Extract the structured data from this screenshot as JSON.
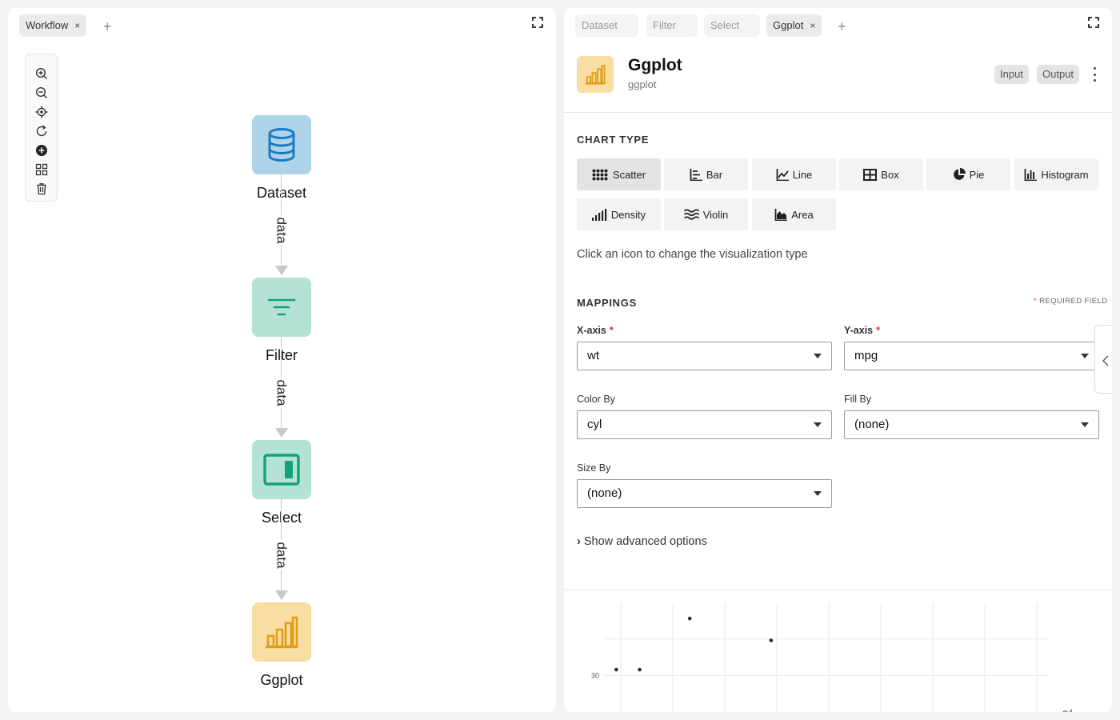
{
  "workflow": {
    "tab_label": "Workflow",
    "close_glyph": "×",
    "add_glyph": "+",
    "toolbar_icons": [
      "zoom-in-icon",
      "zoom-out-icon",
      "center-icon",
      "refresh-icon",
      "add-node-icon",
      "layout-icon",
      "trash-icon"
    ],
    "nodes": [
      {
        "label": "Dataset",
        "color": "#aed4ea",
        "icon": "database-icon"
      },
      {
        "label": "Filter",
        "color": "#b4e3d5",
        "icon": "filter-icon"
      },
      {
        "label": "Select",
        "color": "#b4e3d5",
        "icon": "select-columns-icon"
      },
      {
        "label": "Ggplot",
        "color": "#f9dea3",
        "icon": "bar-chart-icon"
      }
    ],
    "edge_label": "data"
  },
  "editor": {
    "tabs": [
      {
        "label": "Dataset"
      },
      {
        "label": "Filter"
      },
      {
        "label": "Select"
      },
      {
        "label": "Ggplot",
        "active": true
      }
    ],
    "close_glyph": "×",
    "add_glyph": "+",
    "node_title": "Ggplot",
    "node_subtitle": "ggplot",
    "input_label": "Input",
    "output_label": "Output",
    "chart_type_heading": "CHART TYPE",
    "chart_types": [
      {
        "label": "Scatter",
        "icon": "scatter-icon",
        "selected": true
      },
      {
        "label": "Bar",
        "icon": "bar-icon"
      },
      {
        "label": "Line",
        "icon": "line-icon"
      },
      {
        "label": "Box",
        "icon": "box-icon"
      },
      {
        "label": "Pie",
        "icon": "pie-icon"
      },
      {
        "label": "Histogram",
        "icon": "histogram-icon"
      },
      {
        "label": "Density",
        "icon": "density-icon"
      },
      {
        "label": "Violin",
        "icon": "violin-icon"
      },
      {
        "label": "Area",
        "icon": "area-icon"
      }
    ],
    "chart_type_hint": "Click an icon to change the visualization type",
    "mappings_heading": "MAPPINGS",
    "required_star": "*",
    "required_note": "REQUIRED FIELD",
    "fields": {
      "x_axis": {
        "label": "X-axis",
        "value": "wt",
        "required": true
      },
      "y_axis": {
        "label": "Y-axis",
        "value": "mpg",
        "required": true
      },
      "color_by": {
        "label": "Color By",
        "value": "cyl"
      },
      "fill_by": {
        "label": "Fill By",
        "value": "(none)"
      },
      "size_by": {
        "label": "Size By",
        "value": "(none)"
      }
    },
    "advanced_chevron": "›",
    "advanced_label": "Show advanced options"
  },
  "chart_data": {
    "type": "scatter",
    "xlabel": "",
    "ylabel": "",
    "y_tick_labels": [
      "30"
    ],
    "legend_title": "cyl",
    "point_color": "#1f2a44",
    "points": [
      {
        "x": 1.61,
        "y": 30.4
      },
      {
        "x": 1.82,
        "y": 30.4
      },
      {
        "x": 2.27,
        "y": 33.9
      },
      {
        "x": 3.0,
        "y": 32.4
      }
    ],
    "xlim": [
      1.5,
      5.5
    ],
    "ylim": [
      27.5,
      35.0
    ],
    "grid": true
  }
}
